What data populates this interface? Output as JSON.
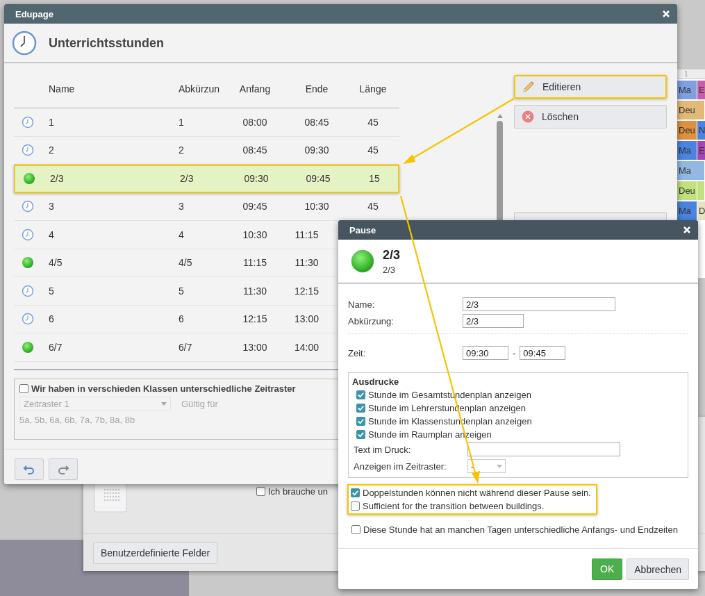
{
  "timetable": {
    "header": "1",
    "rows": [
      [
        {
          "text": "Ma",
          "color": "#7f9fe0"
        },
        {
          "text": "E",
          "color": "#c75fa8"
        }
      ],
      [
        {
          "text": "Deu",
          "color": "#e3b978"
        }
      ],
      [
        {
          "text": "Deu",
          "color": "#e0913f"
        },
        {
          "text": "N",
          "color": "#4a84e0"
        }
      ],
      [
        {
          "text": "Ma",
          "color": "#4a84e0"
        },
        {
          "text": "E",
          "color": "#a445b3"
        }
      ],
      [
        {
          "text": "Ma",
          "color": "#93b9e3"
        }
      ],
      [
        {
          "text": "Deu",
          "color": "#c3e07e"
        },
        {
          "text": "",
          "color": "#c3e07e"
        }
      ],
      [
        {
          "text": "Ma",
          "color": "#4a84e0"
        },
        {
          "text": "D",
          "color": "#e6e3c2"
        }
      ]
    ]
  },
  "back_dialog": {
    "option": {
      "label": "Ich brauche un",
      "checked": false
    },
    "button": "Benutzerdefinierte Felder"
  },
  "main_dialog": {
    "title": "Edupage",
    "heading": "Unterrichtsstunden",
    "table": {
      "columns": [
        "Name",
        "Abkürzun",
        "Anfang",
        "Ende",
        "Länge"
      ],
      "rows": [
        {
          "kind": "lesson",
          "name": "1",
          "abbr": "1",
          "start": "08:00",
          "end": "08:45",
          "length": "45",
          "selected": false,
          "highlighted": false
        },
        {
          "kind": "lesson",
          "name": "2",
          "abbr": "2",
          "start": "08:45",
          "end": "09:30",
          "length": "45",
          "selected": false,
          "highlighted": false
        },
        {
          "kind": "break",
          "name": "2/3",
          "abbr": "2/3",
          "start": "09:30",
          "end": "09:45",
          "length": "15",
          "selected": true,
          "highlighted": true
        },
        {
          "kind": "lesson",
          "name": "3",
          "abbr": "3",
          "start": "09:45",
          "end": "10:30",
          "length": "45",
          "selected": false,
          "highlighted": false
        },
        {
          "kind": "lesson",
          "name": "4",
          "abbr": "4",
          "start": "10:30",
          "end": "11:15",
          "selected": false,
          "highlighted": false
        },
        {
          "kind": "break",
          "name": "4/5",
          "abbr": "4/5",
          "start": "11:15",
          "end": "11:30",
          "selected": false,
          "highlighted": false
        },
        {
          "kind": "lesson",
          "name": "5",
          "abbr": "5",
          "start": "11:30",
          "end": "12:15",
          "selected": false,
          "highlighted": false
        },
        {
          "kind": "lesson",
          "name": "6",
          "abbr": "6",
          "start": "12:15",
          "end": "13:00",
          "selected": false,
          "highlighted": false
        },
        {
          "kind": "break",
          "name": "6/7",
          "abbr": "6/7",
          "start": "13:00",
          "end": "14:00",
          "selected": false,
          "highlighted": false
        }
      ]
    },
    "buttons": [
      {
        "kind": "edit",
        "label": "Editieren",
        "highlighted": true
      },
      {
        "kind": "delete",
        "label": "Löschen",
        "highlighted": false
      },
      {
        "kind": "blank",
        "highlighted": false
      }
    ],
    "timegrid_option": {
      "label": "Wir haben in verschieden Klassen unterschiedliche Zeitraster",
      "checked": false,
      "select_value": "Zeitraster 1",
      "valid_label": "Gültig für",
      "classes": "5a, 5b, 6a, 6b, 7a, 7b, 8a, 8b",
      "disabled": true
    }
  },
  "pause_dialog": {
    "title": "Pause",
    "name": "2/3",
    "abbr": "2/3",
    "fields": [
      {
        "label": "Name:",
        "value": "2/3",
        "kind": "wide"
      },
      {
        "label": "Abkürzung:",
        "value": "2/3",
        "kind": "short"
      }
    ],
    "time": {
      "label": "Zeit:",
      "start": "09:30",
      "separator": "-",
      "end": "09:45"
    },
    "printouts": {
      "title": "Ausdrucke",
      "options": [
        {
          "label": "Stunde im Gesamtstundenplan anzeigen",
          "checked": true
        },
        {
          "label": "Stunde im Lehrerstundenplan anzeigen",
          "checked": true
        },
        {
          "label": "Stunde im Klassenstundenplan anzeigen",
          "checked": true
        },
        {
          "label": "Stunde im Raumplan anzeigen",
          "checked": true
        }
      ],
      "text_label": "Text im Druck:",
      "grid_label": "Anzeigen im Zeitraster:",
      "grid_value": "-"
    },
    "highlighted_options": [
      {
        "label": "Doppelstunden können nicht während dieser Pause sein.",
        "checked": true
      },
      {
        "label": "Sufficient for the transition between buildings.",
        "checked": false
      }
    ],
    "extra_option": {
      "label": "Diese Stunde hat an manchen Tagen unterschiedliche Anfangs- und Endzeiten",
      "checked": false
    },
    "buttons": [
      {
        "kind": "primary",
        "label": "OK"
      },
      {
        "kind": "secondary",
        "label": "Abbrechen"
      }
    ]
  }
}
